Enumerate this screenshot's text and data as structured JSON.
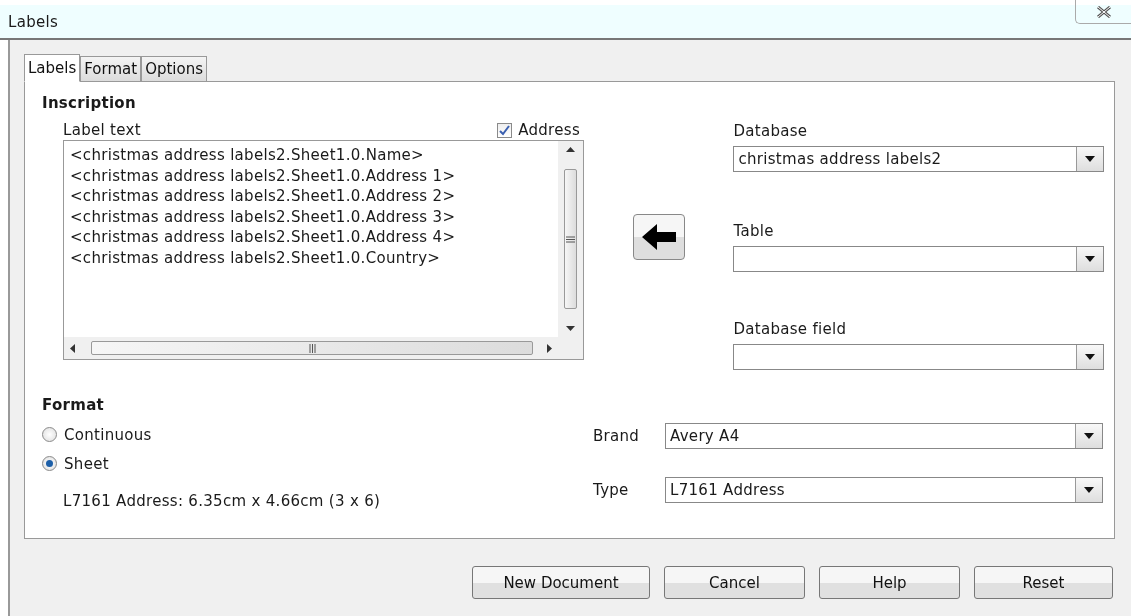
{
  "window": {
    "title": "Labels"
  },
  "tabs": [
    {
      "label": "Labels",
      "selected": true
    },
    {
      "label": "Format",
      "selected": false
    },
    {
      "label": "Options",
      "selected": false
    }
  ],
  "inscription": {
    "heading": "Inscription",
    "caption": "Label text",
    "address_checkbox": {
      "label": "Address",
      "checked": true
    },
    "lines": [
      "<christmas address labels2.Sheet1.0.Name>",
      "<christmas address labels2.Sheet1.0.Address 1>",
      "<christmas address labels2.Sheet1.0.Address 2>",
      "<christmas address labels2.Sheet1.0.Address 3>",
      "<christmas address labels2.Sheet1.0.Address 4>",
      "<christmas address labels2.Sheet1.0.Country>"
    ]
  },
  "database": {
    "label": "Database",
    "value": "christmas address labels2"
  },
  "table": {
    "label": "Table"
  },
  "database_field": {
    "label": "Database field"
  },
  "format": {
    "heading": "Format",
    "options": [
      {
        "label": "Continuous",
        "selected": false
      },
      {
        "label": "Sheet",
        "selected": true
      }
    ],
    "brand": {
      "label": "Brand",
      "value": "Avery A4"
    },
    "type": {
      "label": "Type",
      "value": "L7161 Address"
    },
    "info": "L7161 Address: 6.35cm x 4.66cm (3 x 6)"
  },
  "buttons": [
    "New Document",
    "Cancel",
    "Help",
    "Reset"
  ]
}
